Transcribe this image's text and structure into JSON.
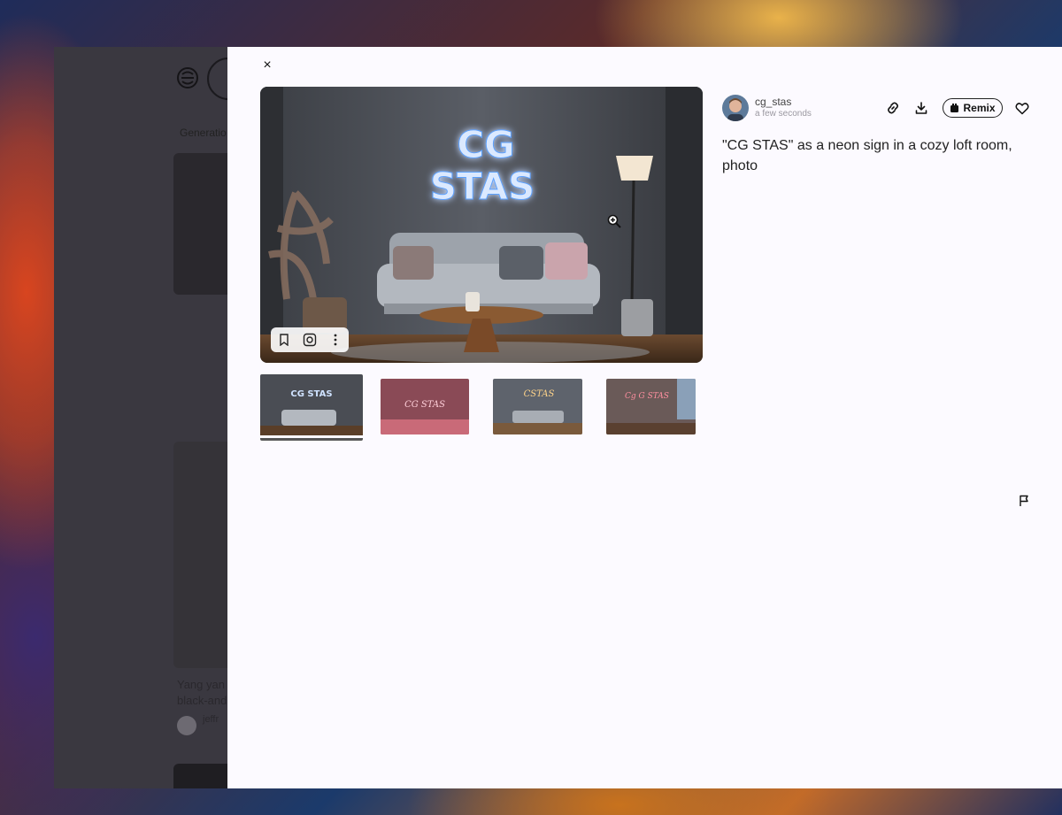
{
  "background_app": {
    "tab_label": "Generatio",
    "card_caption": "Yang yan\nblack-and",
    "card_user": "jeffr"
  },
  "modal": {
    "close_label": "×",
    "main_image": {
      "neon_line1": "CG",
      "neon_line2": "STAS"
    },
    "thumbnails": [
      {
        "text": "CG STAS",
        "accent": "#6aa8ff"
      },
      {
        "text": "CG STAS",
        "accent": "#ff6b8a"
      },
      {
        "text": "CSTAS",
        "accent": "#f4b24a"
      },
      {
        "text": "Cg G STAS",
        "accent": "#ff5a6e"
      }
    ],
    "author": {
      "name": "cg_stas",
      "time": "a few seconds"
    },
    "remix_label": "Remix",
    "prompt": "\"CG STAS\" as a neon sign in a cozy loft room, photo"
  },
  "icons": [
    "close-icon",
    "bookmark-icon",
    "camera-search-icon",
    "more-vertical-icon",
    "zoom-in-icon",
    "link-icon",
    "download-icon",
    "remix-icon",
    "heart-icon",
    "flag-icon"
  ],
  "colors": {
    "modal_bg": "#fcfaff",
    "overlay_bg": "#3a3840",
    "neon_blue": "#5aa0ff"
  }
}
